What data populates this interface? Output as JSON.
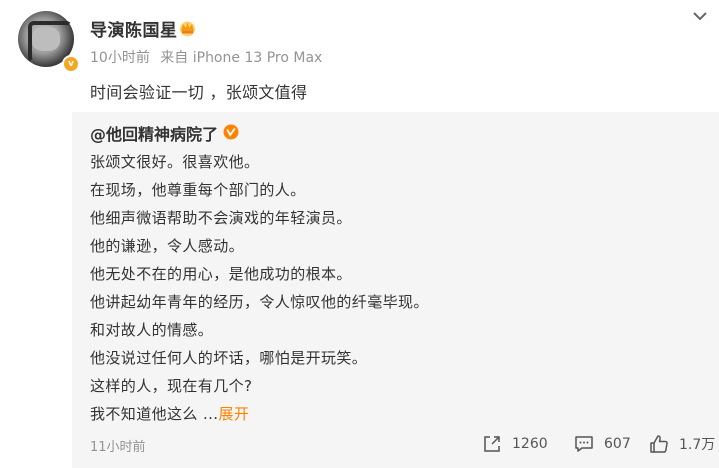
{
  "post": {
    "author": "导演陈国星",
    "time": "10小时前",
    "source": "来自 iPhone 13 Pro Max",
    "content": "时间会验证一切 ，张颂文值得"
  },
  "repost": {
    "author": "@他回精神病院了",
    "lines": [
      "张颂文很好。很喜欢他。",
      "在现场，他尊重每个部门的人。",
      "他细声微语帮助不会演戏的年轻演员。",
      "他的谦逊，令人感动。",
      "他无处不在的用心，是他成功的根本。",
      "他讲起幼年青年的经历，令人惊叹他的纤毫毕现。",
      "和对故人的情感。",
      "他没说过任何人的坏话，哪怕是开玩笑。",
      "这样的人，现在有几个?",
      "我不知道他这么 ..."
    ],
    "expand_label": "展开",
    "time": "11小时前",
    "repost_count": "1260",
    "comment_count": "607",
    "like_count": "1.7万"
  },
  "colors": {
    "accent": "#ff8200",
    "verified": "#f5a623",
    "repost_bg": "#f5f5f5",
    "meta_text": "#939393"
  },
  "icons": {
    "avatar_badge": "verified-badge-icon",
    "crown": "crown-icon",
    "menu": "chevron-down-icon",
    "repost_author_badge": "verified-orange-icon",
    "repost": "repost-icon",
    "comment": "comment-icon",
    "like": "like-icon"
  }
}
